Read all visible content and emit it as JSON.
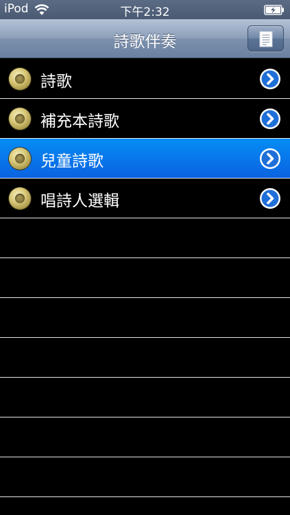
{
  "status_bar": {
    "carrier": "iPod",
    "time": "下午2:32"
  },
  "nav": {
    "title": "詩歌伴奏",
    "right_button_icon": "document-icon"
  },
  "list": {
    "items": [
      {
        "label": "詩歌",
        "selected": false
      },
      {
        "label": "補充本詩歌",
        "selected": false
      },
      {
        "label": "兒童詩歌",
        "selected": true
      },
      {
        "label": "唱詩人選輯",
        "selected": false
      }
    ],
    "empty_rows": 7
  },
  "colors": {
    "selected_row": "#0a7af0",
    "disclosure": "#1f6fd8",
    "nav_bar": "#8da0ba"
  }
}
